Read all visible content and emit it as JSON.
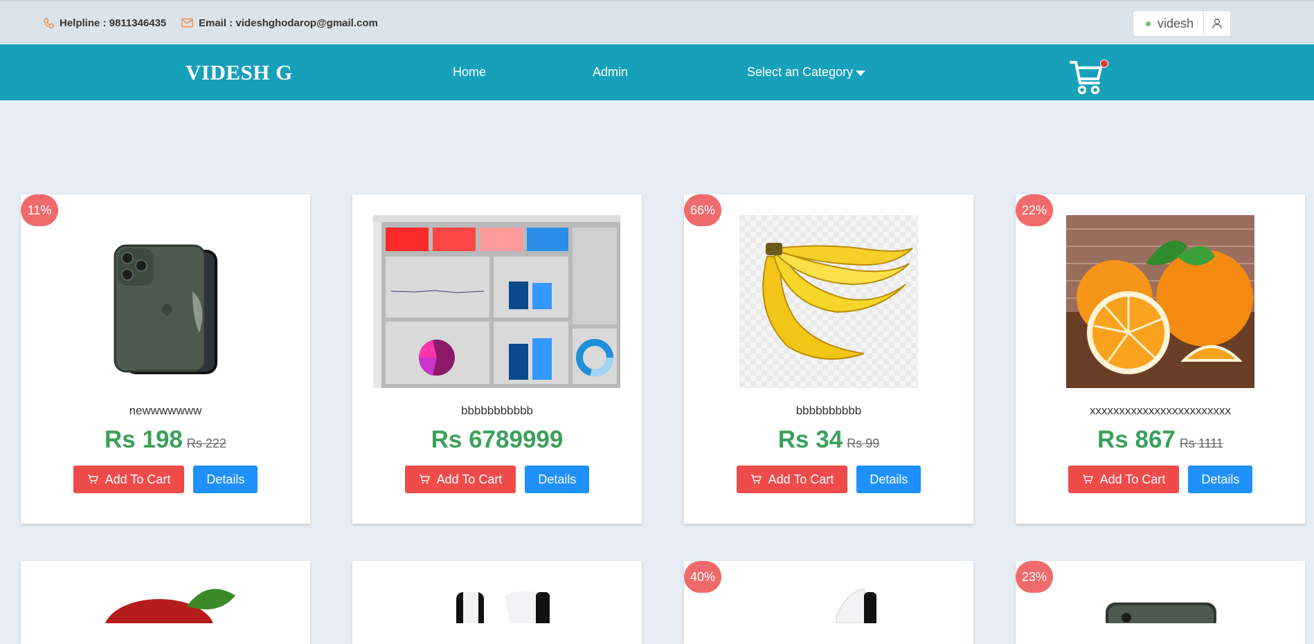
{
  "topbar": {
    "helpline": "Helpline : 9811346435",
    "email": "Email : videshghodarop@gmail.com",
    "user": "videsh"
  },
  "nav": {
    "brand": "VIDESH G",
    "home": "Home",
    "admin": "Admin",
    "category": "Select an Category"
  },
  "buttons": {
    "add_to_cart": "Add To Cart",
    "details": "Details"
  },
  "products": [
    {
      "discount": "11%",
      "name": "newwwwwww",
      "price": "Rs 198",
      "old_price": "Rs 222"
    },
    {
      "discount": "",
      "name": "bbbbbbbbbbb",
      "price": "Rs 6789999",
      "old_price": ""
    },
    {
      "discount": "66%",
      "name": "bbbbbbbbbb",
      "price": "Rs 34",
      "old_price": "Rs 99"
    },
    {
      "discount": "22%",
      "name": "xxxxxxxxxxxxxxxxxxxxxxxx",
      "price": "Rs 867",
      "old_price": "Rs 1111"
    }
  ],
  "products_row2": [
    {
      "discount": ""
    },
    {
      "discount": ""
    },
    {
      "discount": "40%"
    },
    {
      "discount": "23%"
    }
  ],
  "colors": {
    "nav": "#17a0ba",
    "price": "#3aa05a",
    "cart_button": "#ef4b4b",
    "details_button": "#1e90ff",
    "badge": "#ef6b6b"
  },
  "icons": [
    "phone-icon",
    "mail-icon",
    "user-icon",
    "shopping-cart-icon",
    "cart-button-icon"
  ]
}
